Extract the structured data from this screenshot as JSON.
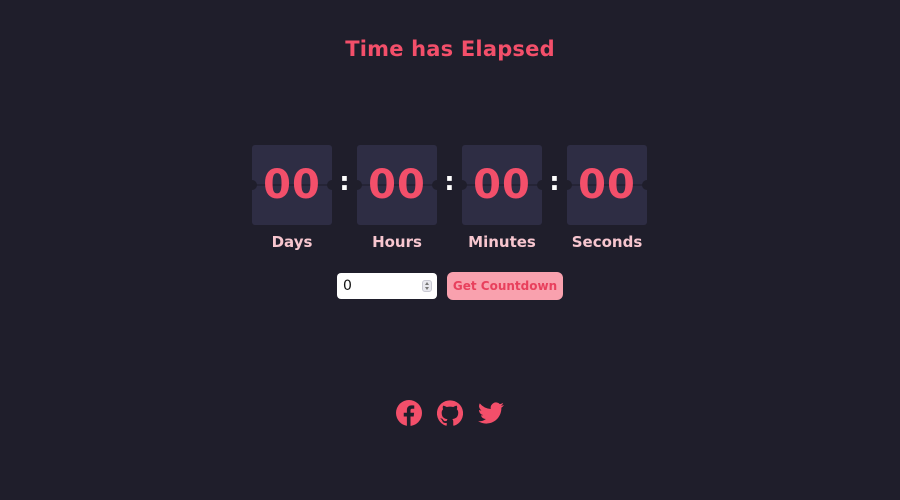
{
  "header": {
    "title": "Time has Elapsed"
  },
  "timer": {
    "units": [
      {
        "value": "00",
        "label": "Days"
      },
      {
        "value": "00",
        "label": "Hours"
      },
      {
        "value": "00",
        "label": "Minutes"
      },
      {
        "value": "00",
        "label": "Seconds"
      }
    ],
    "separator": ":"
  },
  "controls": {
    "input_value": "0",
    "button_label": "Get Countdown"
  },
  "social": {
    "icons": [
      "facebook-icon",
      "github-icon",
      "twitter-icon"
    ]
  },
  "colors": {
    "background": "#1f1e2b",
    "accent": "#f34f6a",
    "card": "#2e2d44",
    "label": "#f7c6cf",
    "button_bg": "#f9a1ae"
  }
}
